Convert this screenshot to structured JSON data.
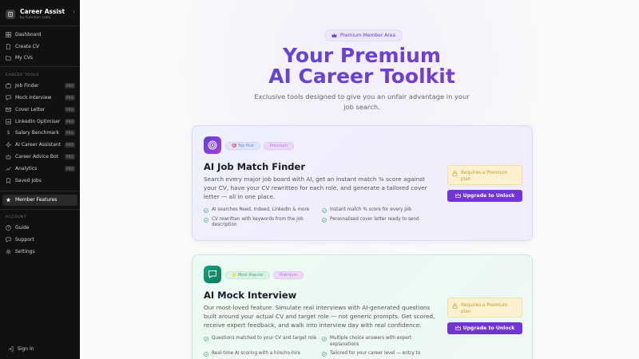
{
  "brand": {
    "title": "Career Assist",
    "subtitle": "by Function Labs",
    "collapse": "‹"
  },
  "nav_main": [
    {
      "label": "Dashboard",
      "icon": "grid-icon"
    },
    {
      "label": "Create CV",
      "icon": "file-icon"
    },
    {
      "label": "My CVs",
      "icon": "folder-icon"
    }
  ],
  "career_tools": {
    "title": "CAREER TOOLS",
    "items": [
      {
        "label": "Job Finder",
        "badge": "PRO"
      },
      {
        "label": "Mock Interview",
        "badge": "PRO"
      },
      {
        "label": "Cover Letter",
        "badge": "PRO"
      },
      {
        "label": "LinkedIn Optimiser",
        "badge": "PRO"
      },
      {
        "label": "Salary Benchmark",
        "badge": "PRO"
      },
      {
        "label": "AI Career Assistant",
        "badge": "PRO"
      },
      {
        "label": "Career Advice Bot",
        "badge": "PRO"
      },
      {
        "label": "Analytics",
        "badge": "PRO"
      },
      {
        "label": "Saved Jobs"
      }
    ]
  },
  "member_features": {
    "label": "Member Features"
  },
  "account": {
    "title": "ACCOUNT",
    "items": [
      {
        "label": "Guide"
      },
      {
        "label": "Support"
      },
      {
        "label": "Settings"
      }
    ]
  },
  "signin": {
    "label": "Sign In"
  },
  "header": {
    "badge": "Premium Member Area",
    "title_line1": "Your Premium",
    "title_line2": "AI Career Toolkit",
    "subtitle": "Exclusive tools designed to give you an unfair advantage in your job search."
  },
  "cards": [
    {
      "tag1": "🎯 Top Pick",
      "tag2": "Premium",
      "title": "AI Job Match Finder",
      "description": "Search every major job board with AI, get an instant match % score against your CV, have your CV rewritten for each role, and generate a tailored cover letter — all in one place.",
      "features": [
        "AI searches Reed, Indeed, LinkedIn & more",
        "Instant match % score for every job",
        "CV rewritten with keywords from the job description",
        "Personalised cover letter ready to send"
      ],
      "lock_text": "Requires a Premium plan",
      "button": "Upgrade to Unlock"
    },
    {
      "tag1": "⭐ Most Popular",
      "tag2": "Premium",
      "title": "AI Mock Interview",
      "description": "Our most-loved feature. Simulate real interviews with AI-generated questions built around your actual CV and target role — not generic prompts. Get scored, receive expert feedback, and walk into interview day with real confidence.",
      "features": [
        "Questions matched to your CV and target role",
        "Multiple choice answers with expert explanations",
        "Real-time AI scoring with a hire/no-hire",
        "Tailored for your career level — entry to"
      ],
      "lock_text": "Requires a Premium plan",
      "button": "Upgrade to Unlock"
    }
  ],
  "colors": {
    "accent": "#7135d6",
    "sidebar": "#111111",
    "success": "#10a37f"
  }
}
